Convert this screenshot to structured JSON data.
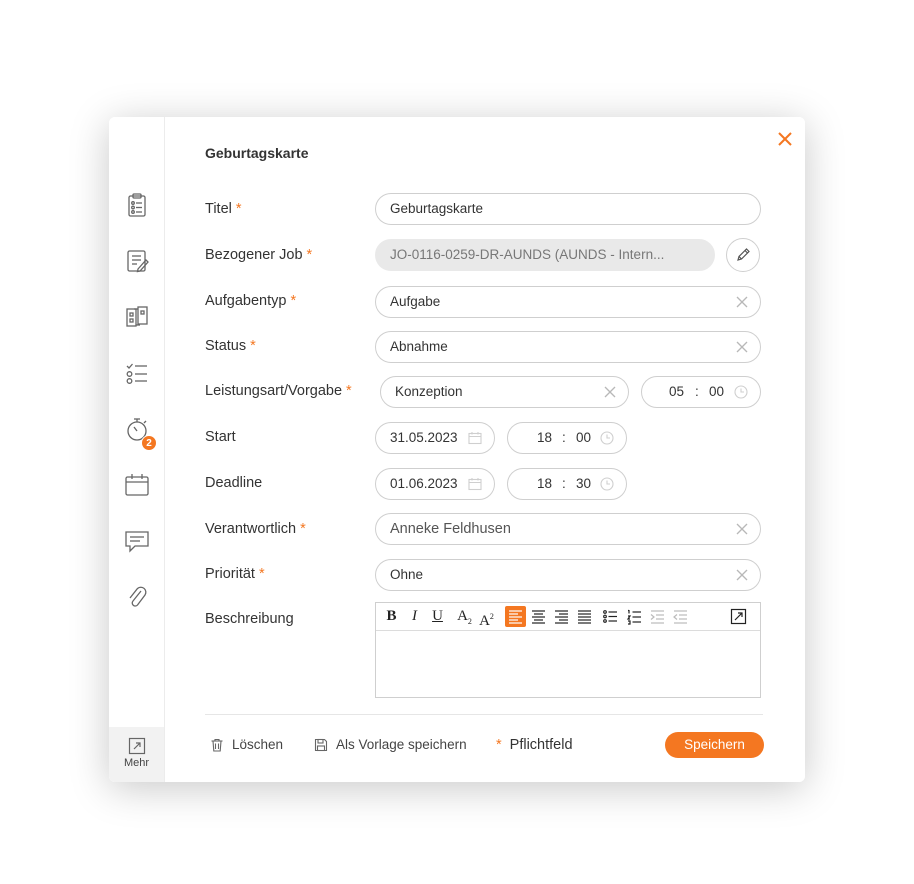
{
  "dialog": {
    "title": "Geburtagskarte"
  },
  "fields": {
    "titel": {
      "label": "Titel",
      "value": "Geburtagskarte"
    },
    "job": {
      "label": "Bezogener Job",
      "value": "JO-0116-0259-DR-AUNDS (AUNDS - Intern..."
    },
    "aufgabentyp": {
      "label": "Aufgabentyp",
      "value": "Aufgabe"
    },
    "status": {
      "label": "Status",
      "value": "Abnahme"
    },
    "leistungsart": {
      "label": "Leistungsart/Vorgabe",
      "value": "Konzeption",
      "hours": "05",
      "minutes": "00"
    },
    "start": {
      "label": "Start",
      "date": "31.05.2023",
      "hours": "18",
      "minutes": "00"
    },
    "deadline": {
      "label": "Deadline",
      "date": "01.06.2023",
      "hours": "18",
      "minutes": "30"
    },
    "verantwortlich": {
      "label": "Verantwortlich",
      "value": "Anneke Feldhusen"
    },
    "prioritaet": {
      "label": "Priorität",
      "value": "Ohne"
    },
    "beschreibung": {
      "label": "Beschreibung"
    }
  },
  "required_marker": "*",
  "time_separator": ":",
  "sidebar": {
    "timer_badge": "2",
    "more_label": "Mehr"
  },
  "footer": {
    "delete_label": "Löschen",
    "template_label": "Als Vorlage speichern",
    "required_note": "Pflichtfeld",
    "save_label": "Speichern"
  },
  "colors": {
    "accent": "#f47721",
    "border": "#cfcfcf",
    "disabled_bg": "#e9e9e9"
  }
}
